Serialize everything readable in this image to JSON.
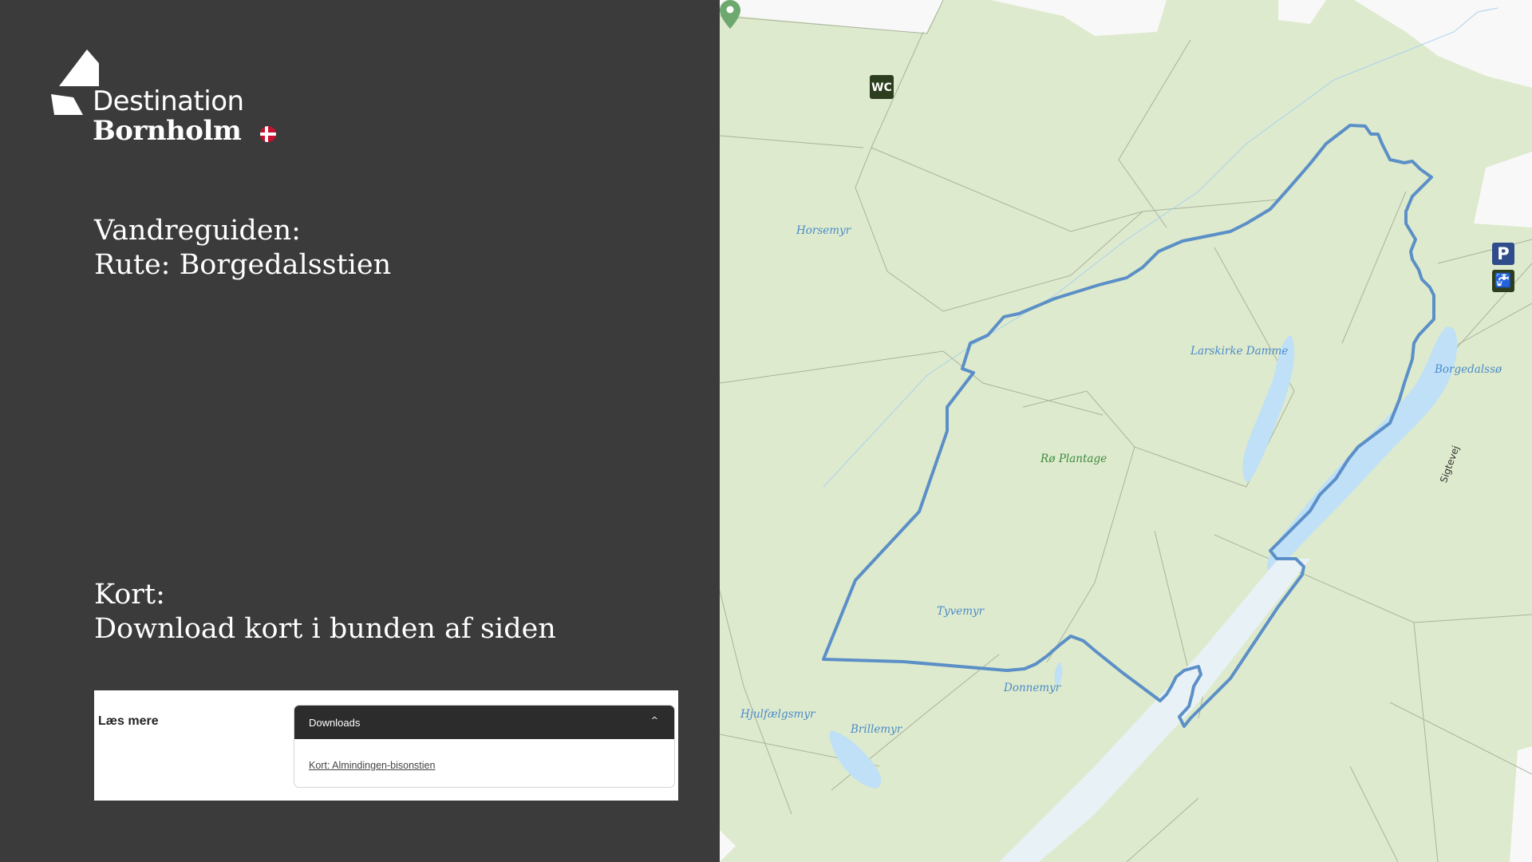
{
  "logo": {
    "line1": "Destination",
    "line2": "Bornholm"
  },
  "heading1": {
    "line1": "Vandreguiden:",
    "line2": "Rute: Borgedalsstien"
  },
  "heading2": {
    "line1": "Kort:",
    "line2": "Download kort i bunden af siden"
  },
  "accordion": {
    "side_label": "Læs mere",
    "title": "Downloads",
    "chevron": "^",
    "link": "Kort: Almindingen-bisonstien"
  },
  "map": {
    "labels": {
      "horsemyr": "Horsemyr",
      "larskirke": "Larskirke Damme",
      "borgedalsso": "Borgedalssø",
      "ro_plantage": "Rø Plantage",
      "tyvemyr": "Tyvemyr",
      "donnemyr": "Donnemyr",
      "hjulfaelgsmyr": "Hjulfælgsmyr",
      "brillemyr": "Brillemyr",
      "sigtevej": "Sigtevej"
    },
    "poi": {
      "wc": "WC",
      "parking": "P",
      "tap": "🚰"
    },
    "colors": {
      "route": "#5b8fc7",
      "water": "#bfe0f7",
      "land": "#deeacd",
      "pin": "#6da86e"
    }
  }
}
